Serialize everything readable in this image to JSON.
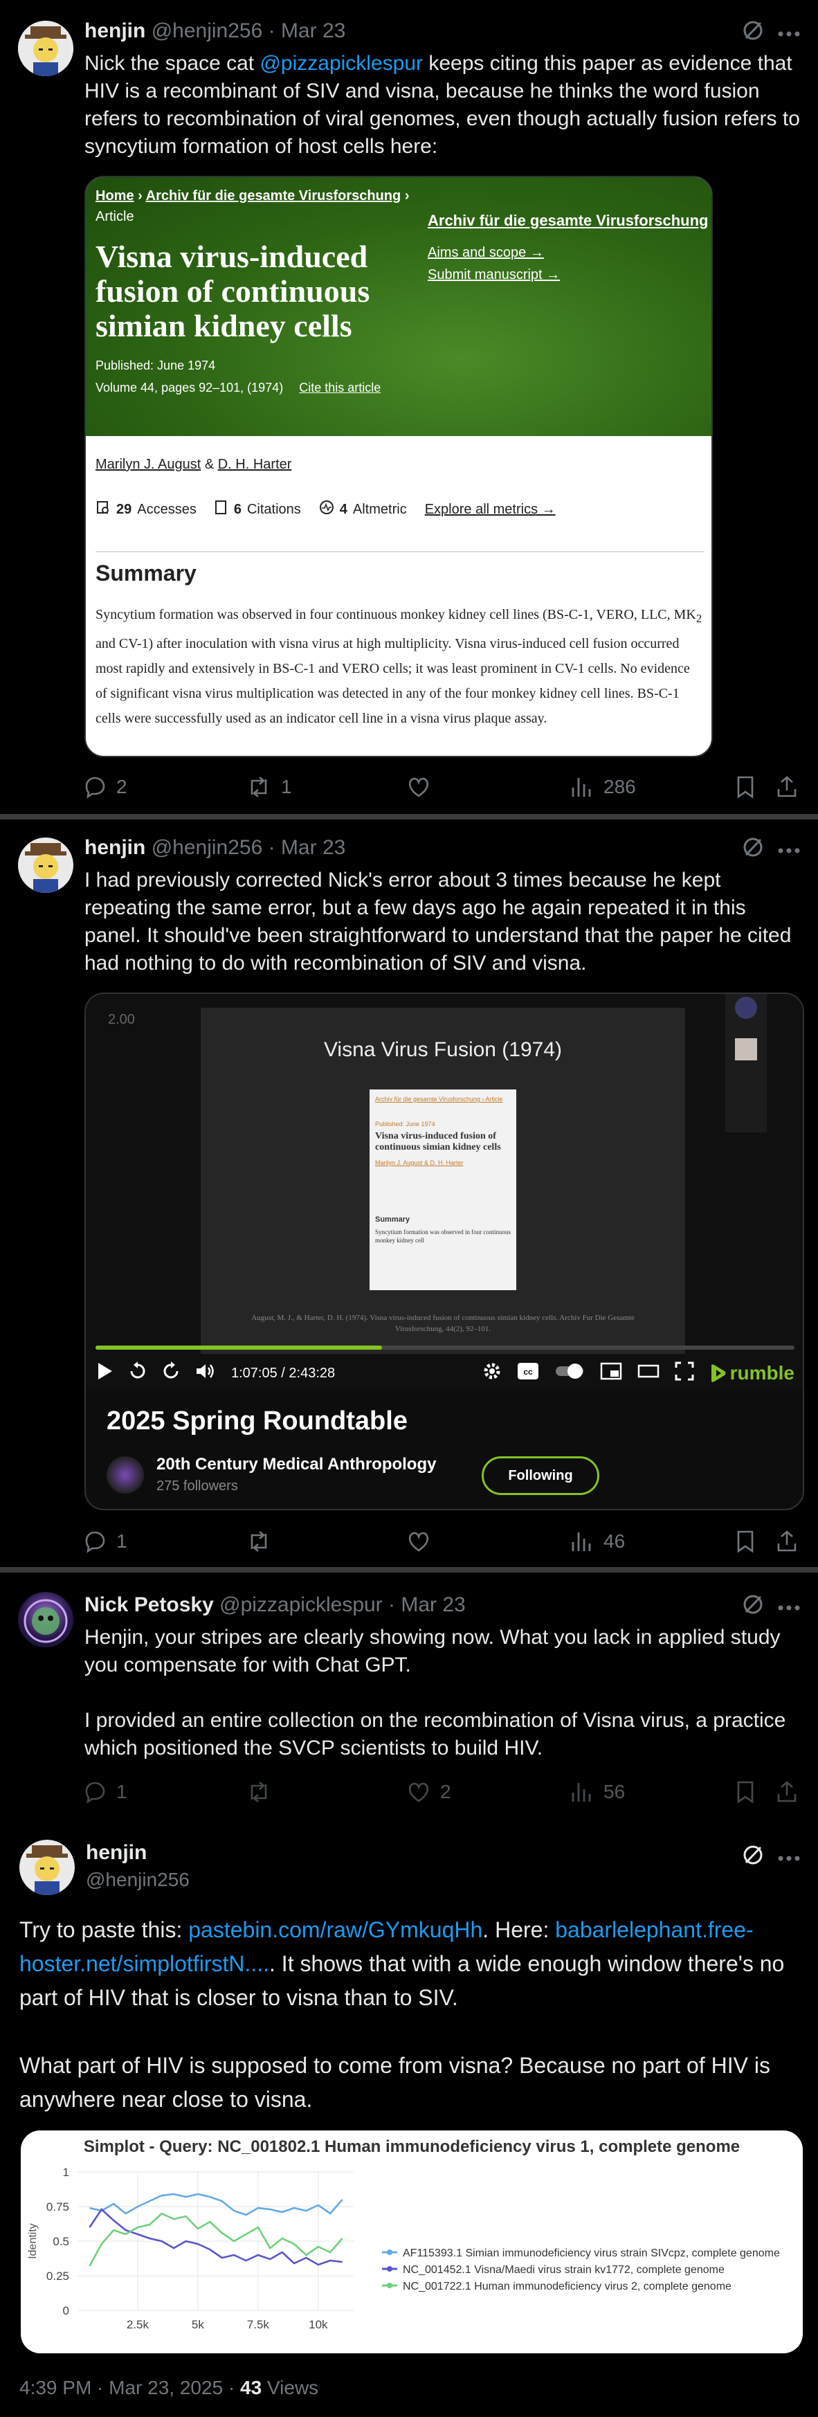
{
  "tweets": [
    {
      "name": "henjin",
      "handle": "@henjin256",
      "date": "Mar 23",
      "text_pre": "Nick the space cat ",
      "mention": "@pizzapicklespur",
      "text_post": " keeps citing this paper as evidence that HIV is a recombinant of SIV and visna, because he thinks the word fusion refers to recombination of viral genomes, even though actually fusion refers to syncytium formation of host cells here:",
      "card": {
        "breadcrumb_home": "Home",
        "breadcrumb_journal": "Archiv für die gesamte Virusforschung",
        "article_type": "Article",
        "title": "Visna virus-induced fusion of continuous simian kidney cells",
        "published": "Published: June 1974",
        "volume": "Volume 44, pages 92–101, (1974)",
        "cite": "Cite this article",
        "journal_link": "Archiv für die gesamte Virusforschung",
        "aims": "Aims and scope →",
        "submit": "Submit manuscript →",
        "authors": "Marilyn J. August",
        "authors_amp": " & ",
        "authors2": "D. H. Harter",
        "accesses_num": "29",
        "accesses_label": "Accesses",
        "citations_num": "6",
        "citations_label": "Citations",
        "altmetric_num": "4",
        "altmetric_label": "Altmetric",
        "explore": "Explore all metrics →",
        "summary_heading": "Summary",
        "summary_a": "Syncytium formation was observed in four continuous monkey kidney cell lines (BS-C-1, VERO, LLC, MK",
        "summary_sub": "2",
        "summary_b": " and CV-1) after inoculation with visna virus at high multiplicity. Visna virus-induced cell fusion occurred most rapidly and extensively in BS-C-1 and VERO cells; it was least prominent in CV-1 cells. No evidence of significant visna virus multiplication was detected in any of the four monkey kidney cell lines. BS-C-1 cells were successfully used as an indicator cell line in a visna virus plaque assay."
      },
      "replies": "2",
      "reposts": "1",
      "likes": "",
      "views": "286"
    },
    {
      "name": "henjin",
      "handle": "@henjin256",
      "date": "Mar 23",
      "text": "I had previously corrected Nick's error about 3 times because he kept repeating the same error, but a few days ago he again repeated it in this panel. It should've been straightforward to understand that the paper he cited had nothing to do with recombination of SIV and visna.",
      "video": {
        "speed": "2.00",
        "slide_title": "Visna Virus Fusion (1974)",
        "slide_caption": "August, M. J., & Harter, D. H. (1974). Visna virus-induced fusion of continuous simian kidney cells. Archiv Fur Die Gesamte Virusforschung, 44(2), 92–101.",
        "mini_journal": "Archiv für die gesamte Virusforschung",
        "mini_article": "Article",
        "mini_published": "Published: June 1974",
        "mini_title": "Visna virus-induced fusion of continuous simian kidney cells",
        "mini_authors": "Marilyn J. August & D. H. Harter",
        "mini_summary": "Summary",
        "mini_summary_text": "Syncytium formation was observed in four continuous monkey kidney cell",
        "time": "1:07:05 / 2:43:28",
        "brand": "rumble",
        "video_title": "2025 Spring Roundtable",
        "channel": "20th Century Medical Anthropology",
        "followers": "275 followers",
        "follow_label": "Following"
      },
      "replies": "1",
      "reposts": "",
      "likes": "",
      "views": "46"
    },
    {
      "name": "Nick Petosky",
      "handle": "@pizzapicklespur",
      "date": "Mar 23",
      "text1": "Henjin, your stripes are clearly showing now. What you lack in applied study you compensate for with Chat GPT.",
      "text2": "I provided an entire collection on the recombination of Visna virus, a practice which positioned the SVCP scientists to build HIV.",
      "replies": "1",
      "reposts": "",
      "likes": "2",
      "views": "56"
    },
    {
      "name": "henjin",
      "handle": "@henjin256",
      "p1_a": "Try to paste this: ",
      "link1": "pastebin.com/raw/GYmkuqHh",
      "p1_b": ". Here: ",
      "link2": "babarlelephant.free-hoster.net/simplotfirstN....",
      "p1_c": ". It shows that with a wide enough window there's no part of HIV that is closer to visna than to SIV.",
      "p2": "What part of HIV is supposed to come from visna? Because no part of HIV is anywhere near close to visna.",
      "footer_time": "4:39 PM · Mar 23, 2025 · ",
      "footer_views_num": "43",
      "footer_views_label": " Views"
    }
  ],
  "chart_data": {
    "type": "line",
    "title": "Simplot - Query: NC_001802.1 Human immunodeficiency virus 1, complete genome",
    "xlabel": "",
    "ylabel": "Identity",
    "xlim": [
      0,
      10000
    ],
    "ylim": [
      0,
      1
    ],
    "x_ticks": [
      "2.5k",
      "5k",
      "7.5k",
      "10k"
    ],
    "y_ticks": [
      "0",
      "0.25",
      "0.5",
      "0.75",
      "1"
    ],
    "grid": true,
    "legend_position": "right",
    "x": [
      500,
      1000,
      1500,
      2000,
      2500,
      3000,
      3500,
      4000,
      4500,
      5000,
      5500,
      6000,
      6500,
      7000,
      7500,
      8000,
      8500,
      9000,
      9500,
      10000,
      10500,
      11000
    ],
    "series": [
      {
        "name": "AF115393.1 Simian immunodeficiency virus strain SIVcpz, complete genome",
        "color": "#63a9e8",
        "values": [
          0.74,
          0.72,
          0.77,
          0.7,
          0.75,
          0.79,
          0.83,
          0.84,
          0.82,
          0.84,
          0.82,
          0.79,
          0.72,
          0.69,
          0.74,
          0.73,
          0.71,
          0.74,
          0.72,
          0.76,
          0.7,
          0.8
        ]
      },
      {
        "name": "NC_001452.1 Visna/Maedi virus strain kv1772, complete genome",
        "color": "#5b55c9",
        "values": [
          0.6,
          0.73,
          0.65,
          0.58,
          0.55,
          0.52,
          0.5,
          0.45,
          0.5,
          0.48,
          0.44,
          0.38,
          0.4,
          0.36,
          0.4,
          0.37,
          0.42,
          0.34,
          0.38,
          0.33,
          0.36,
          0.35
        ]
      },
      {
        "name": "NC_001722.1 Human immunodeficiency virus 2, complete genome",
        "color": "#6fd17c",
        "values": [
          0.32,
          0.48,
          0.58,
          0.55,
          0.6,
          0.62,
          0.7,
          0.66,
          0.68,
          0.59,
          0.64,
          0.56,
          0.5,
          0.55,
          0.6,
          0.45,
          0.52,
          0.48,
          0.4,
          0.46,
          0.42,
          0.52
        ]
      }
    ]
  }
}
